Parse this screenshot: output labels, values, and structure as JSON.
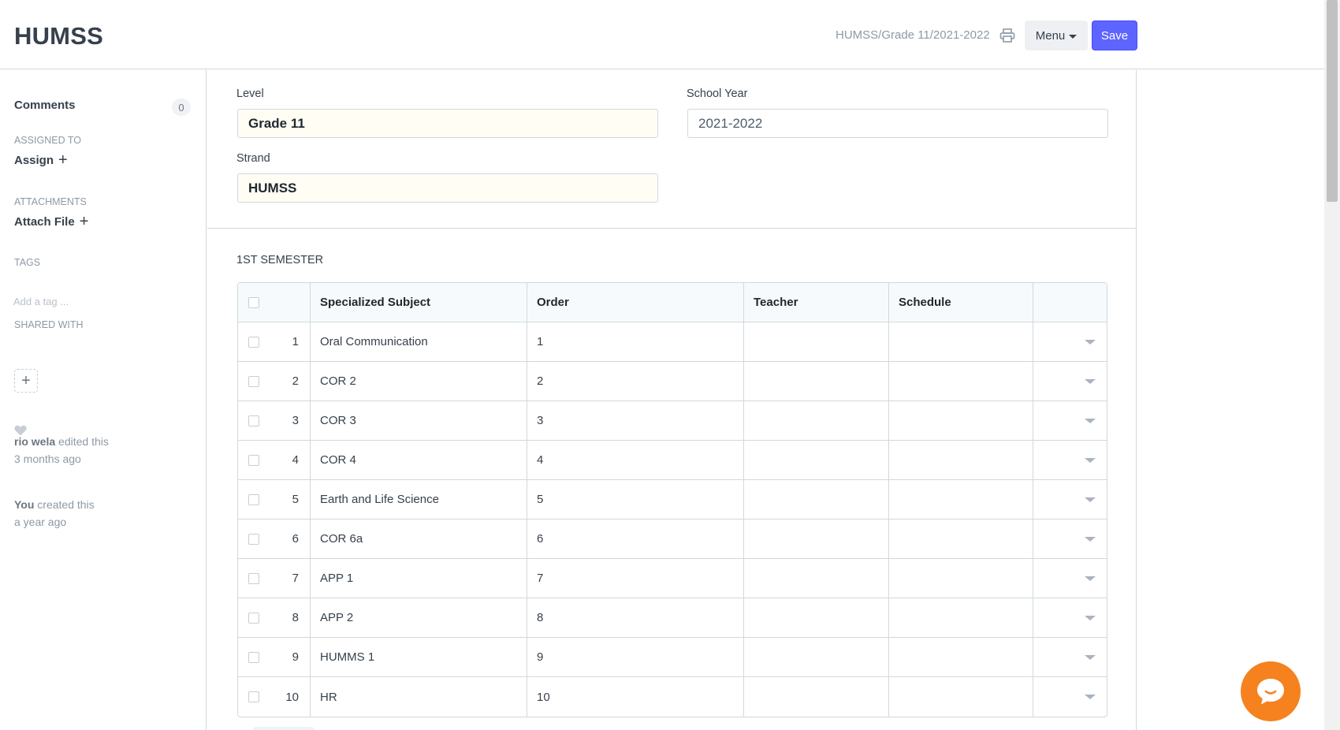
{
  "header": {
    "title": "HUMSS",
    "doc_path": "HUMSS/Grade 11/2021-2022",
    "menu_label": "Menu",
    "save_label": "Save"
  },
  "sidebar": {
    "comments_label": "Comments",
    "comments_count": "0",
    "assigned_to_label": "ASSIGNED TO",
    "assign_label": "Assign",
    "attachments_label": "ATTACHMENTS",
    "attach_label": "Attach File",
    "tags_label": "TAGS",
    "tag_placeholder": "Add a tag ...",
    "shared_with_label": "SHARED WITH",
    "activity": [
      {
        "user": "rio wela",
        "action": " edited this",
        "time": "3 months ago"
      },
      {
        "user": "You",
        "action": " created this",
        "time": "a year ago"
      }
    ]
  },
  "form": {
    "level_label": "Level",
    "level_value": "Grade 11",
    "school_year_label": "School Year",
    "school_year_value": "2021-2022",
    "strand_label": "Strand",
    "strand_value": "HUMSS"
  },
  "section": {
    "title": "1ST SEMESTER",
    "columns": [
      "Specialized Subject",
      "Order",
      "Teacher",
      "Schedule"
    ],
    "rows": [
      {
        "idx": "1",
        "subject": "Oral Communication",
        "order": "1",
        "teacher": "",
        "schedule": ""
      },
      {
        "idx": "2",
        "subject": "COR 2",
        "order": "2",
        "teacher": "",
        "schedule": ""
      },
      {
        "idx": "3",
        "subject": "COR 3",
        "order": "3",
        "teacher": "",
        "schedule": ""
      },
      {
        "idx": "4",
        "subject": "COR 4",
        "order": "4",
        "teacher": "",
        "schedule": ""
      },
      {
        "idx": "5",
        "subject": "Earth and Life Science",
        "order": "5",
        "teacher": "",
        "schedule": ""
      },
      {
        "idx": "6",
        "subject": "COR 6a",
        "order": "6",
        "teacher": "",
        "schedule": ""
      },
      {
        "idx": "7",
        "subject": "APP 1",
        "order": "7",
        "teacher": "",
        "schedule": ""
      },
      {
        "idx": "8",
        "subject": "APP 2",
        "order": "8",
        "teacher": "",
        "schedule": ""
      },
      {
        "idx": "9",
        "subject": "HUMMS 1",
        "order": "9",
        "teacher": "",
        "schedule": ""
      },
      {
        "idx": "10",
        "subject": "HR",
        "order": "10",
        "teacher": "",
        "schedule": ""
      }
    ]
  },
  "icons": {
    "print": "printer-icon",
    "menu_caret": "caret-down-icon",
    "plus": "plus-icon",
    "heart": "heart-icon",
    "row_menu": "caret-down-icon",
    "chat": "chat-bubble-icon"
  },
  "colors": {
    "primary": "#5e64ff",
    "chat": "#f5821f",
    "mandatory_bg": "#fffdf4",
    "border": "#d1d8dd"
  }
}
